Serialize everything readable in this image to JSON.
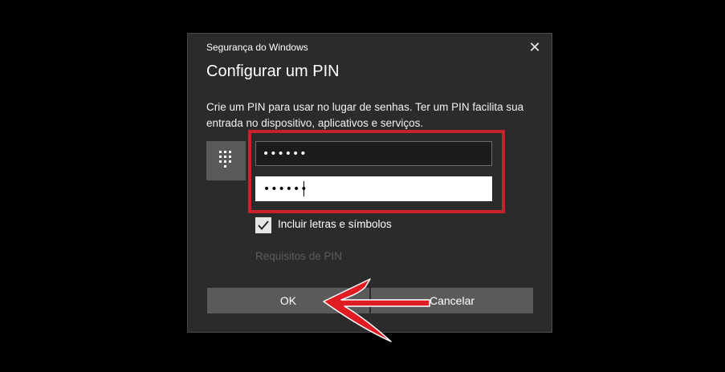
{
  "dialog": {
    "window_title": "Segurança do Windows",
    "heading": "Configurar um PIN",
    "description": "Crie um PIN para usar no lugar de senhas. Ter um PIN facilita sua entrada no dispositivo, aplicativos e serviços.",
    "close_icon": "close-icon",
    "keypad_icon": "keypad-icon"
  },
  "pin": {
    "new_pin_value": "••••••",
    "confirm_pin_value": "••••••"
  },
  "options": {
    "include_letters_label": "Incluir letras e símbolos",
    "include_letters_checked": true,
    "pin_requirements_link": "Requisitos de PIN"
  },
  "buttons": {
    "ok_label": "OK",
    "cancel_label": "Cancelar"
  },
  "annotation": {
    "highlight_color": "#c8232b",
    "arrow_color": "#e01b22"
  },
  "colors": {
    "dialog_bg": "#2b2b2b",
    "button_bg": "#5a5a5a",
    "page_bg": "#000000"
  }
}
